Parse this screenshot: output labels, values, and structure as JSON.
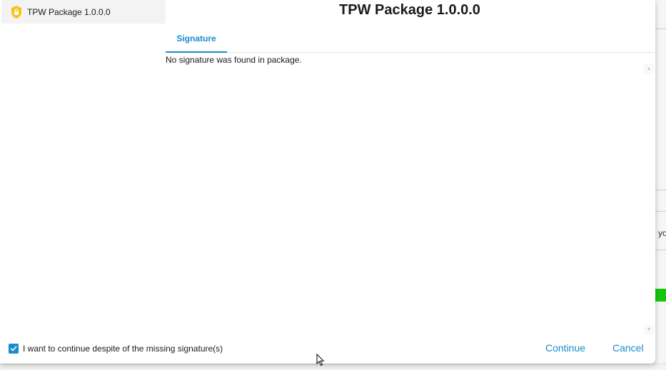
{
  "package_list": {
    "items": [
      {
        "label": "TPW Package 1.0.0.0",
        "icon": "shield-lock-icon",
        "icon_color": "#f5c518"
      }
    ]
  },
  "dialog": {
    "title": "TPW Package 1.0.0.0"
  },
  "tabs": [
    {
      "label": "Signature",
      "active": true
    }
  ],
  "content": {
    "message": "No signature was found in package."
  },
  "footer": {
    "checkbox_label": "I want to continue despite of the missing signature(s)",
    "checkbox_checked": true,
    "continue_label": "Continue",
    "cancel_label": "Cancel"
  },
  "background": {
    "partial_text": "yo"
  },
  "colors": {
    "accent": "#1a8ccc",
    "shield": "#f5c518",
    "status_green": "#16c60c"
  }
}
